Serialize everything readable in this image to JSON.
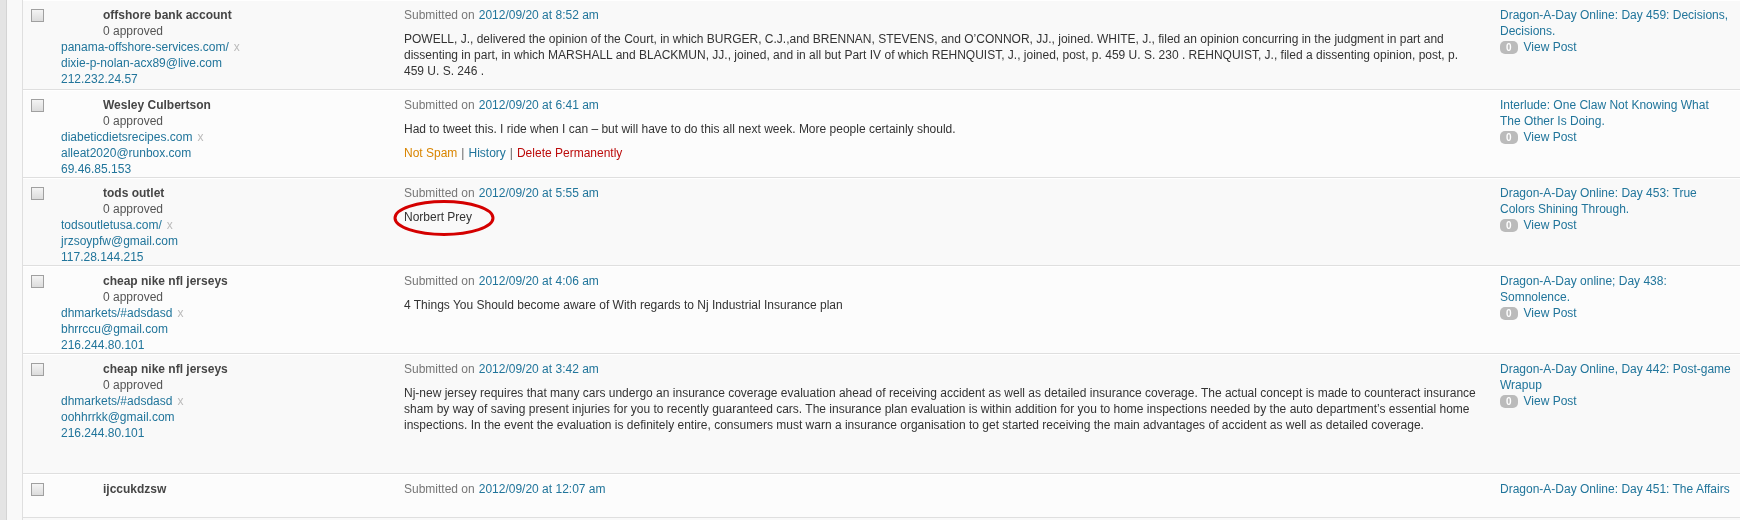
{
  "comments": [
    {
      "checked": false,
      "author": "offshore bank account",
      "approved": "0 approved",
      "url": "panama-offshore-services.com/",
      "url_remove": "x",
      "email": "dixie-p-nolan-acx89@live.com",
      "ip": "212.232.24.57",
      "submitted_label": "Submitted on",
      "date": "2012/09/20 at 8:52 am",
      "text": "POWELL, J., delivered the opinion of the Court, in which BURGER, C.J.,and BRENNAN, STEVENS, and O’CONNOR, JJ., joined. WHITE, J., filed an opinion concurring in the judgment in part and dissenting in part, in which MARSHALL and BLACKMUN, JJ., joined, and in all but Part IV of which REHNQUIST, J., joined, post, p. 459 U. S. 230 . REHNQUIST, J., filed a dissenting opinion, post, p. 459 U. S. 246 .",
      "highlighted": false,
      "post_title": "Dragon-A-Day Online: Day 459: Decisions, Decisions.",
      "count": "0",
      "view_post": "View Post"
    },
    {
      "checked": false,
      "author": "Wesley Culbertson",
      "approved": "0 approved",
      "url": "diabeticdietsrecipes.com",
      "url_remove": "x",
      "email": "alleat2020@runbox.com",
      "ip": "69.46.85.153",
      "submitted_label": "Submitted on",
      "date": "2012/09/20 at 6:41 am",
      "text": "Had to tweet this. I ride when I can – but will have to do this all next week. More people certainly should.",
      "highlighted": false,
      "actions": [
        {
          "label": "Not Spam",
          "kind": "restore"
        },
        {
          "separator": "|",
          "label": "History",
          "kind": "info"
        },
        {
          "separator": "|",
          "label": "Delete Permanently",
          "kind": "delete"
        }
      ],
      "post_title": "Interlude: One Claw Not Knowing What The Other Is Doing.",
      "count": "0",
      "view_post": "View Post"
    },
    {
      "checked": false,
      "author": "tods outlet",
      "approved": "0 approved",
      "url": "todsoutletusa.com/",
      "url_remove": "x",
      "email": "jrzsoypfw@gmail.com",
      "ip": "117.28.144.215",
      "submitted_label": "Submitted on",
      "date": "2012/09/20 at 5:55 am",
      "text": "Norbert Prey",
      "highlighted": true,
      "post_title": "Dragon-A-Day Online: Day 453: True Colors Shining Through.",
      "count": "0",
      "view_post": "View Post"
    },
    {
      "checked": false,
      "author": "cheap nike nfl jerseys",
      "approved": "0 approved",
      "url": "dhmarkets/#adsdasd",
      "url_remove": "x",
      "email": "bhrrccu@gmail.com",
      "ip": "216.244.80.101",
      "submitted_label": "Submitted on",
      "date": "2012/09/20 at 4:06 am",
      "text": "4 Things You Should become aware of With regards to Nj Industrial Insurance plan",
      "highlighted": false,
      "post_title": "Dragon-A-Day online; Day 438: Somnolence.",
      "count": "0",
      "view_post": "View Post"
    },
    {
      "checked": false,
      "author": "cheap nike nfl jerseys",
      "approved": "0 approved",
      "url": "dhmarkets/#adsdasd",
      "url_remove": "x",
      "email": "oohhrrkk@gmail.com",
      "ip": "216.244.80.101",
      "submitted_label": "Submitted on",
      "date": "2012/09/20 at 3:42 am",
      "text": "Nj-new jersey requires that many cars undergo an insurance coverage evaluation ahead of receiving accident as well as detailed insurance coverage. The actual concept is made to counteract insurance sham by way of saving present injuries for you to recently guaranteed cars. The insurance plan evaluation is within addition for you to home inspections needed by the auto department’s essential home inspections. In the event the evaluation is definitely entire, consumers must warn a insurance organisation to get started receiving the main advantages of accident as well as detailed coverage.",
      "highlighted": false,
      "post_title": "Dragon-A-Day Online, Day 442: Post-game Wrapup",
      "count": "0",
      "view_post": "View Post"
    },
    {
      "checked": false,
      "author": "ijccukdzsw",
      "submitted_label": "Submitted on",
      "date": "2012/09/20 at 12:07 am",
      "post_title": "Dragon-A-Day Online: Day 451: The Affairs"
    }
  ]
}
